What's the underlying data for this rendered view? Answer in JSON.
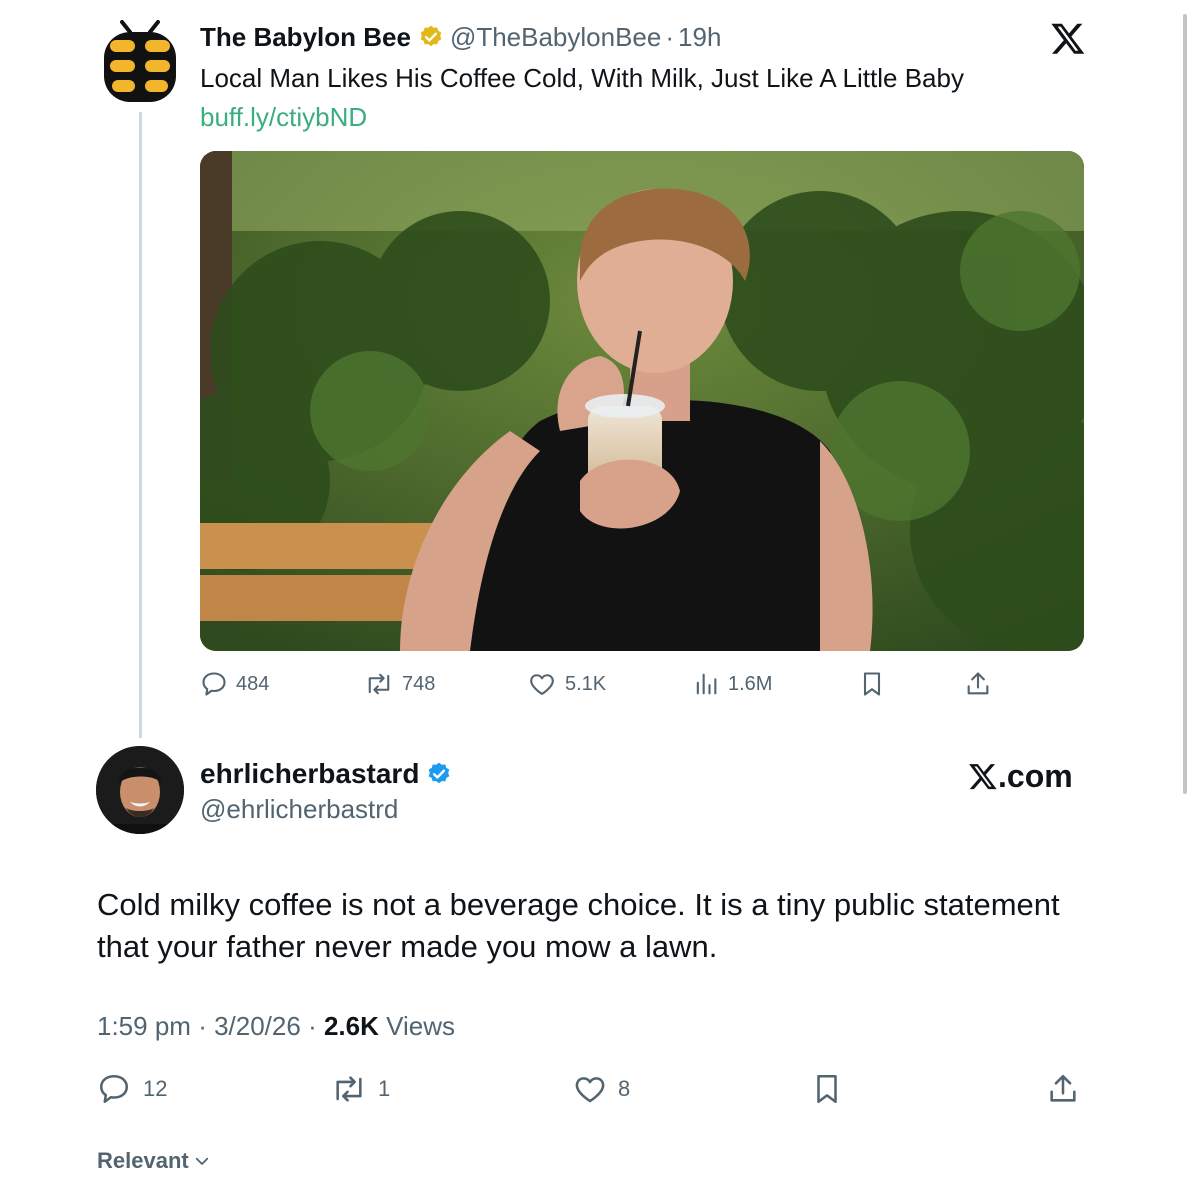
{
  "quoted_tweet": {
    "author_name": "The Babylon Bee",
    "handle": "@TheBabylonBee",
    "separator": "·",
    "time": "19h",
    "text": "Local Man Likes His Coffee Cold, With Milk, Just Like A Little Baby",
    "link": "buff.ly/ctiybND",
    "image_alt": "man sipping iced coffee on a bench",
    "stats": {
      "replies": "484",
      "reposts": "748",
      "likes": "5.1K",
      "views": "1.6M"
    }
  },
  "main_tweet": {
    "author_name": "ehrlicherbastard",
    "handle": "@ehrlicherbastrd",
    "brand": ".com",
    "text": "Cold milky coffee is not a beverage choice. It is a tiny public statement that your father never made you mow a lawn.",
    "time": "1:59 pm",
    "date": "3/20/26",
    "views_count": "2.6K",
    "views_label": "Views",
    "stats": {
      "replies": "12",
      "reposts": "1",
      "likes": "8"
    }
  },
  "footer": {
    "sort_label": "Relevant"
  },
  "colors": {
    "text": "#0f1419",
    "secondary": "#536471",
    "link": "#3aae7c",
    "verified_gold": "#e2b719",
    "verified_blue": "#1d9bf0"
  }
}
